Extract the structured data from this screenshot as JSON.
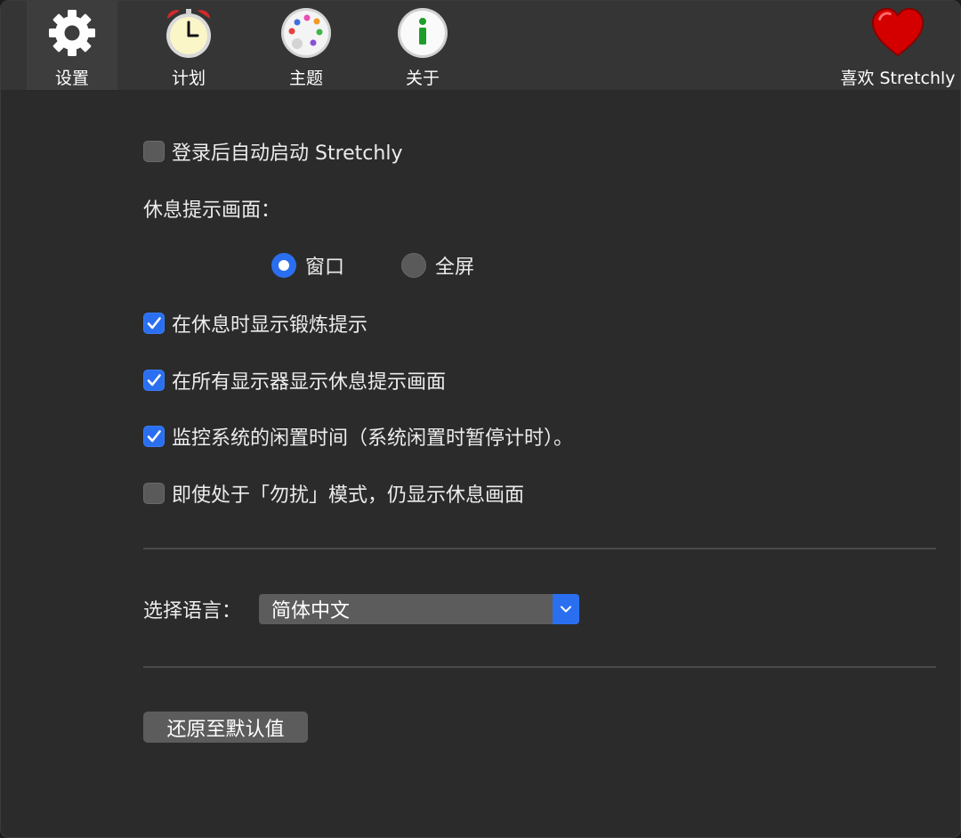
{
  "nav": {
    "settings": {
      "label": "设置",
      "icon": "gear-icon"
    },
    "schedule": {
      "label": "计划",
      "icon": "alarm-clock-icon"
    },
    "theme": {
      "label": "主题",
      "icon": "palette-icon"
    },
    "about": {
      "label": "关于",
      "icon": "info-icon"
    },
    "love": {
      "label": "喜欢 Stretchly",
      "icon": "heart-icon"
    }
  },
  "settings": {
    "auto_start": {
      "label": "登录后自动启动 Stretchly",
      "checked": false
    },
    "break_screen_label": "休息提示画面：",
    "break_screen_options": [
      {
        "label": "窗口",
        "selected": true
      },
      {
        "label": "全屏",
        "selected": false
      }
    ],
    "show_exercise": {
      "label": "在休息时显示锻炼提示",
      "checked": true
    },
    "all_monitors": {
      "label": "在所有显示器显示休息提示画面",
      "checked": true
    },
    "monitor_idle": {
      "label": "监控系统的闲置时间（系统闲置时暂停计时）。",
      "checked": true
    },
    "dnd_show": {
      "label": "即使处于「勿扰」模式，仍显示休息画面",
      "checked": false
    },
    "language_label": "选择语言：",
    "language_value": "简体中文",
    "reset_label": "还原至默认值"
  },
  "colors": {
    "accent": "#2a6ff0",
    "background": "#2b2b2b",
    "nav_background": "#353535",
    "heart": "#d40000"
  }
}
